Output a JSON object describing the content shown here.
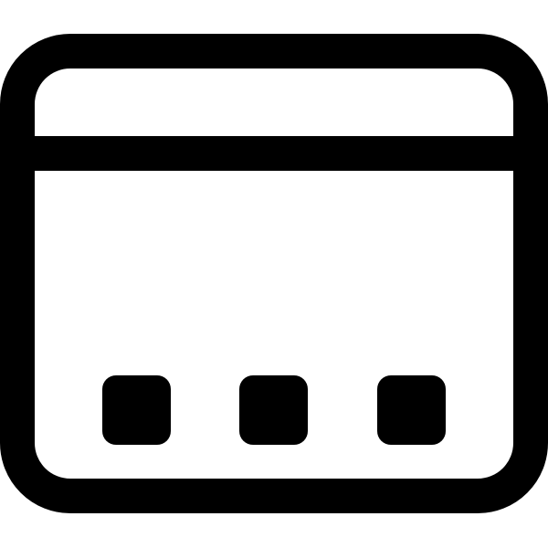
{
  "icon": {
    "name": "app-window-dock-icon",
    "stroke_color": "#000000",
    "background_color": "#ffffff",
    "dock_item_count": 3
  }
}
